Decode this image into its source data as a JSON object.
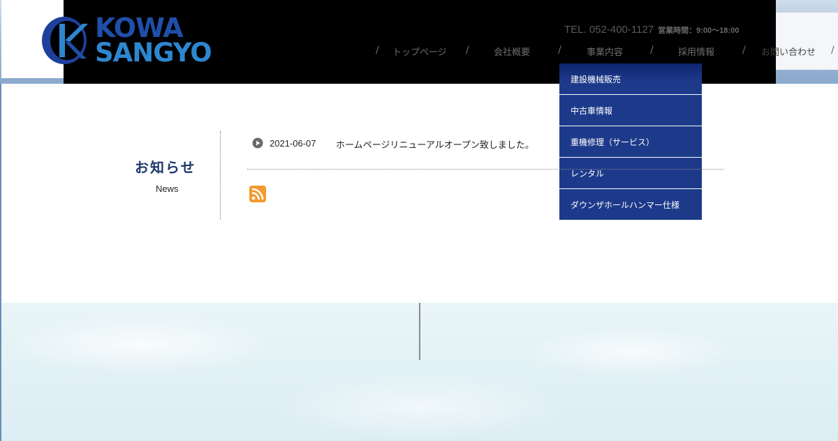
{
  "brand": {
    "line1": "KOWA",
    "line2": "SANGYO",
    "colors": {
      "primary": "#1f4fa8",
      "secondary": "#2e86d0"
    }
  },
  "header": {
    "tel": "TEL. 052-400-1127",
    "hours": "営業時間：9:00～18:00"
  },
  "nav": {
    "items": [
      {
        "label": "トップページ"
      },
      {
        "label": "会社概要"
      },
      {
        "label": "事業内容"
      },
      {
        "label": "採用情報"
      },
      {
        "label": "お問い合わせ"
      }
    ],
    "separator": "/"
  },
  "dropdown": {
    "items": [
      {
        "label": "建設機械販売"
      },
      {
        "label": "中古車情報"
      },
      {
        "label": "重機修理（サービス）"
      },
      {
        "label": "レンタル"
      },
      {
        "label": "ダウンザホールハンマー仕様"
      }
    ],
    "color": "#1d3a8a"
  },
  "news": {
    "title": "お知らせ",
    "subtitle": "News",
    "entries": [
      {
        "date": "2021-06-07",
        "text": "ホームページリニューアルオープン致しました。"
      }
    ]
  },
  "icons": {
    "play": "play-circle-icon",
    "rss": "rss-icon"
  }
}
